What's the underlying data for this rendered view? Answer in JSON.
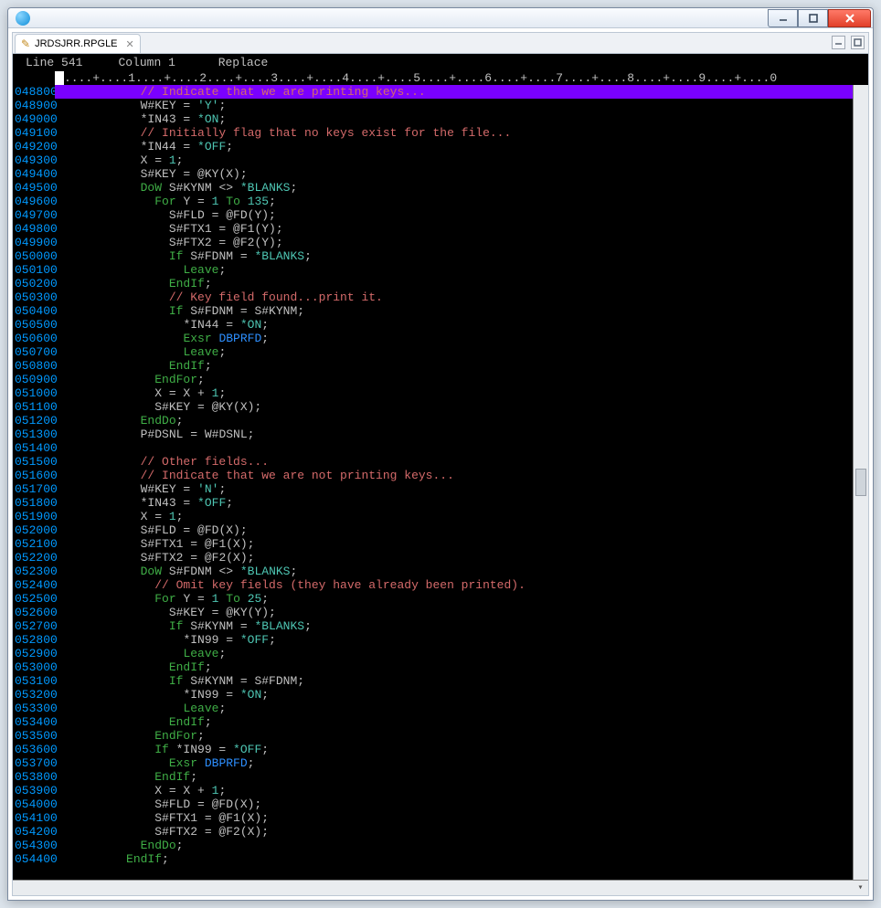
{
  "window": {
    "title": ""
  },
  "tab": {
    "filename": "JRDSJRR.RPGLE"
  },
  "status": {
    "line_label": "Line",
    "line": "541",
    "column_label": "Column",
    "column": "1",
    "mode": "Replace"
  },
  "ruler": "....+....1....+....2....+....3....+....4....+....5....+....6....+....7....+....8....+....9....+....0",
  "code": [
    {
      "n": "048800",
      "i": 12,
      "t": "comment",
      "s": "// Indicate that we are printing keys...",
      "hl": true
    },
    {
      "n": "048900",
      "i": 12,
      "t": "stmt",
      "s": [
        [
          "grey",
          "W#KEY = "
        ],
        [
          "teal",
          "'Y'"
        ],
        [
          "grey",
          ";"
        ]
      ]
    },
    {
      "n": "049000",
      "i": 12,
      "t": "stmt",
      "s": [
        [
          "grey",
          "*IN43 = "
        ],
        [
          "teal",
          "*ON"
        ],
        [
          "grey",
          ";"
        ]
      ]
    },
    {
      "n": "049100",
      "i": 12,
      "t": "comment",
      "s": "// Initially flag that no keys exist for the file..."
    },
    {
      "n": "049200",
      "i": 12,
      "t": "stmt",
      "s": [
        [
          "grey",
          "*IN44 = "
        ],
        [
          "teal",
          "*OFF"
        ],
        [
          "grey",
          ";"
        ]
      ]
    },
    {
      "n": "049300",
      "i": 12,
      "t": "stmt",
      "s": [
        [
          "grey",
          "X = "
        ],
        [
          "teal",
          "1"
        ],
        [
          "grey",
          ";"
        ]
      ]
    },
    {
      "n": "049400",
      "i": 12,
      "t": "stmt",
      "s": [
        [
          "grey",
          "S#KEY = @KY(X);"
        ]
      ]
    },
    {
      "n": "049500",
      "i": 12,
      "t": "stmt",
      "s": [
        [
          "green",
          "DoW "
        ],
        [
          "grey",
          "S#KYNM <> "
        ],
        [
          "teal",
          "*BLANKS"
        ],
        [
          "grey",
          ";"
        ]
      ]
    },
    {
      "n": "049600",
      "i": 14,
      "t": "stmt",
      "s": [
        [
          "green",
          "For "
        ],
        [
          "grey",
          "Y = "
        ],
        [
          "teal",
          "1"
        ],
        [
          "green",
          " To "
        ],
        [
          "teal",
          "135"
        ],
        [
          "grey",
          ";"
        ]
      ]
    },
    {
      "n": "049700",
      "i": 16,
      "t": "stmt",
      "s": [
        [
          "grey",
          "S#FLD = @FD(Y);"
        ]
      ]
    },
    {
      "n": "049800",
      "i": 16,
      "t": "stmt",
      "s": [
        [
          "grey",
          "S#FTX1 = @F1(Y);"
        ]
      ]
    },
    {
      "n": "049900",
      "i": 16,
      "t": "stmt",
      "s": [
        [
          "grey",
          "S#FTX2 = @F2(Y);"
        ]
      ]
    },
    {
      "n": "050000",
      "i": 16,
      "t": "stmt",
      "s": [
        [
          "green",
          "If "
        ],
        [
          "grey",
          "S#FDNM = "
        ],
        [
          "teal",
          "*BLANKS"
        ],
        [
          "grey",
          ";"
        ]
      ]
    },
    {
      "n": "050100",
      "i": 18,
      "t": "stmt",
      "s": [
        [
          "green",
          "Leave"
        ],
        [
          "grey",
          ";"
        ]
      ]
    },
    {
      "n": "050200",
      "i": 16,
      "t": "stmt",
      "s": [
        [
          "green",
          "EndIf"
        ],
        [
          "grey",
          ";"
        ]
      ]
    },
    {
      "n": "050300",
      "i": 16,
      "t": "comment",
      "s": "// Key field found...print it."
    },
    {
      "n": "050400",
      "i": 16,
      "t": "stmt",
      "s": [
        [
          "green",
          "If "
        ],
        [
          "grey",
          "S#FDNM = S#KYNM;"
        ]
      ]
    },
    {
      "n": "050500",
      "i": 18,
      "t": "stmt",
      "s": [
        [
          "grey",
          "*IN44 = "
        ],
        [
          "teal",
          "*ON"
        ],
        [
          "grey",
          ";"
        ]
      ]
    },
    {
      "n": "050600",
      "i": 18,
      "t": "stmt",
      "s": [
        [
          "green",
          "Exsr "
        ],
        [
          "blue",
          "DBPRFD"
        ],
        [
          "grey",
          ";"
        ]
      ]
    },
    {
      "n": "050700",
      "i": 18,
      "t": "stmt",
      "s": [
        [
          "green",
          "Leave"
        ],
        [
          "grey",
          ";"
        ]
      ]
    },
    {
      "n": "050800",
      "i": 16,
      "t": "stmt",
      "s": [
        [
          "green",
          "EndIf"
        ],
        [
          "grey",
          ";"
        ]
      ]
    },
    {
      "n": "050900",
      "i": 14,
      "t": "stmt",
      "s": [
        [
          "green",
          "EndFor"
        ],
        [
          "grey",
          ";"
        ]
      ]
    },
    {
      "n": "051000",
      "i": 14,
      "t": "stmt",
      "s": [
        [
          "grey",
          "X = X + "
        ],
        [
          "teal",
          "1"
        ],
        [
          "grey",
          ";"
        ]
      ]
    },
    {
      "n": "051100",
      "i": 14,
      "t": "stmt",
      "s": [
        [
          "grey",
          "S#KEY = @KY(X);"
        ]
      ]
    },
    {
      "n": "051200",
      "i": 12,
      "t": "stmt",
      "s": [
        [
          "green",
          "EndDo"
        ],
        [
          "grey",
          ";"
        ]
      ]
    },
    {
      "n": "051300",
      "i": 12,
      "t": "stmt",
      "s": [
        [
          "grey",
          "P#DSNL = W#DSNL;"
        ]
      ]
    },
    {
      "n": "051400",
      "i": 12,
      "t": "blank",
      "s": ""
    },
    {
      "n": "051500",
      "i": 12,
      "t": "comment",
      "s": "// Other fields..."
    },
    {
      "n": "051600",
      "i": 12,
      "t": "comment",
      "s": "// Indicate that we are not printing keys..."
    },
    {
      "n": "051700",
      "i": 12,
      "t": "stmt",
      "s": [
        [
          "grey",
          "W#KEY = "
        ],
        [
          "teal",
          "'N'"
        ],
        [
          "grey",
          ";"
        ]
      ]
    },
    {
      "n": "051800",
      "i": 12,
      "t": "stmt",
      "s": [
        [
          "grey",
          "*IN43 = "
        ],
        [
          "teal",
          "*OFF"
        ],
        [
          "grey",
          ";"
        ]
      ]
    },
    {
      "n": "051900",
      "i": 12,
      "t": "stmt",
      "s": [
        [
          "grey",
          "X = "
        ],
        [
          "teal",
          "1"
        ],
        [
          "grey",
          ";"
        ]
      ]
    },
    {
      "n": "052000",
      "i": 12,
      "t": "stmt",
      "s": [
        [
          "grey",
          "S#FLD = @FD(X);"
        ]
      ]
    },
    {
      "n": "052100",
      "i": 12,
      "t": "stmt",
      "s": [
        [
          "grey",
          "S#FTX1 = @F1(X);"
        ]
      ]
    },
    {
      "n": "052200",
      "i": 12,
      "t": "stmt",
      "s": [
        [
          "grey",
          "S#FTX2 = @F2(X);"
        ]
      ]
    },
    {
      "n": "052300",
      "i": 12,
      "t": "stmt",
      "s": [
        [
          "green",
          "DoW "
        ],
        [
          "grey",
          "S#FDNM <> "
        ],
        [
          "teal",
          "*BLANKS"
        ],
        [
          "grey",
          ";"
        ]
      ]
    },
    {
      "n": "052400",
      "i": 14,
      "t": "comment",
      "s": "// Omit key fields (they have already been printed)."
    },
    {
      "n": "052500",
      "i": 14,
      "t": "stmt",
      "s": [
        [
          "green",
          "For "
        ],
        [
          "grey",
          "Y = "
        ],
        [
          "teal",
          "1"
        ],
        [
          "green",
          " To "
        ],
        [
          "teal",
          "25"
        ],
        [
          "grey",
          ";"
        ]
      ]
    },
    {
      "n": "052600",
      "i": 16,
      "t": "stmt",
      "s": [
        [
          "grey",
          "S#KEY = @KY(Y);"
        ]
      ]
    },
    {
      "n": "052700",
      "i": 16,
      "t": "stmt",
      "s": [
        [
          "green",
          "If "
        ],
        [
          "grey",
          "S#KYNM = "
        ],
        [
          "teal",
          "*BLANKS"
        ],
        [
          "grey",
          ";"
        ]
      ]
    },
    {
      "n": "052800",
      "i": 18,
      "t": "stmt",
      "s": [
        [
          "grey",
          "*IN99 = "
        ],
        [
          "teal",
          "*OFF"
        ],
        [
          "grey",
          ";"
        ]
      ]
    },
    {
      "n": "052900",
      "i": 18,
      "t": "stmt",
      "s": [
        [
          "green",
          "Leave"
        ],
        [
          "grey",
          ";"
        ]
      ]
    },
    {
      "n": "053000",
      "i": 16,
      "t": "stmt",
      "s": [
        [
          "green",
          "EndIf"
        ],
        [
          "grey",
          ";"
        ]
      ]
    },
    {
      "n": "053100",
      "i": 16,
      "t": "stmt",
      "s": [
        [
          "green",
          "If "
        ],
        [
          "grey",
          "S#KYNM = S#FDNM;"
        ]
      ]
    },
    {
      "n": "053200",
      "i": 18,
      "t": "stmt",
      "s": [
        [
          "grey",
          "*IN99 = "
        ],
        [
          "teal",
          "*ON"
        ],
        [
          "grey",
          ";"
        ]
      ]
    },
    {
      "n": "053300",
      "i": 18,
      "t": "stmt",
      "s": [
        [
          "green",
          "Leave"
        ],
        [
          "grey",
          ";"
        ]
      ]
    },
    {
      "n": "053400",
      "i": 16,
      "t": "stmt",
      "s": [
        [
          "green",
          "EndIf"
        ],
        [
          "grey",
          ";"
        ]
      ]
    },
    {
      "n": "053500",
      "i": 14,
      "t": "stmt",
      "s": [
        [
          "green",
          "EndFor"
        ],
        [
          "grey",
          ";"
        ]
      ]
    },
    {
      "n": "053600",
      "i": 14,
      "t": "stmt",
      "s": [
        [
          "green",
          "If "
        ],
        [
          "grey",
          "*IN99 = "
        ],
        [
          "teal",
          "*OFF"
        ],
        [
          "grey",
          ";"
        ]
      ]
    },
    {
      "n": "053700",
      "i": 16,
      "t": "stmt",
      "s": [
        [
          "green",
          "Exsr "
        ],
        [
          "blue",
          "DBPRFD"
        ],
        [
          "grey",
          ";"
        ]
      ]
    },
    {
      "n": "053800",
      "i": 14,
      "t": "stmt",
      "s": [
        [
          "green",
          "EndIf"
        ],
        [
          "grey",
          ";"
        ]
      ]
    },
    {
      "n": "053900",
      "i": 14,
      "t": "stmt",
      "s": [
        [
          "grey",
          "X = X + "
        ],
        [
          "teal",
          "1"
        ],
        [
          "grey",
          ";"
        ]
      ]
    },
    {
      "n": "054000",
      "i": 14,
      "t": "stmt",
      "s": [
        [
          "grey",
          "S#FLD = @FD(X);"
        ]
      ]
    },
    {
      "n": "054100",
      "i": 14,
      "t": "stmt",
      "s": [
        [
          "grey",
          "S#FTX1 = @F1(X);"
        ]
      ]
    },
    {
      "n": "054200",
      "i": 14,
      "t": "stmt",
      "s": [
        [
          "grey",
          "S#FTX2 = @F2(X);"
        ]
      ]
    },
    {
      "n": "054300",
      "i": 12,
      "t": "stmt",
      "s": [
        [
          "green",
          "EndDo"
        ],
        [
          "grey",
          ";"
        ]
      ]
    },
    {
      "n": "054400",
      "i": 10,
      "t": "stmt",
      "s": [
        [
          "green",
          "EndIf"
        ],
        [
          "grey",
          ";"
        ]
      ]
    }
  ]
}
